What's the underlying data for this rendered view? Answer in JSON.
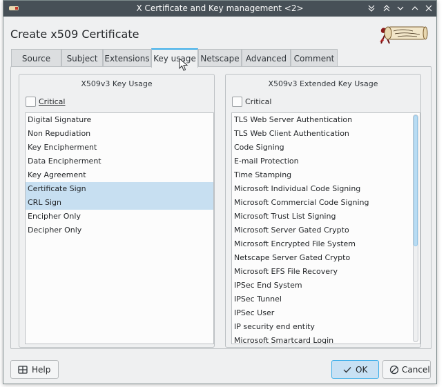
{
  "window": {
    "title": "X Certificate and Key management <2>"
  },
  "header": {
    "title": "Create x509 Certificate",
    "logo_icon": "certificate-scroll-logo"
  },
  "tabs": [
    {
      "label": "Source"
    },
    {
      "label": "Subject"
    },
    {
      "label": "Extensions"
    },
    {
      "label": "Key usage",
      "active": true
    },
    {
      "label": "Netscape"
    },
    {
      "label": "Advanced"
    },
    {
      "label": "Comment"
    }
  ],
  "key_usage": {
    "title": "X509v3 Key Usage",
    "critical_label": "Critical",
    "critical_checked": false,
    "items": [
      {
        "label": "Digital Signature",
        "selected": false
      },
      {
        "label": "Non Repudiation",
        "selected": false
      },
      {
        "label": "Key Encipherment",
        "selected": false
      },
      {
        "label": "Data Encipherment",
        "selected": false
      },
      {
        "label": "Key Agreement",
        "selected": false
      },
      {
        "label": "Certificate Sign",
        "selected": true
      },
      {
        "label": "CRL Sign",
        "selected": true
      },
      {
        "label": "Encipher Only",
        "selected": false
      },
      {
        "label": "Decipher Only",
        "selected": false
      }
    ]
  },
  "extended_key_usage": {
    "title": "X509v3 Extended Key Usage",
    "critical_label": "Critical",
    "critical_checked": false,
    "items": [
      "TLS Web Server Authentication",
      "TLS Web Client Authentication",
      "Code Signing",
      "E-mail Protection",
      "Time Stamping",
      "Microsoft Individual Code Signing",
      "Microsoft Commercial Code Signing",
      "Microsoft Trust List Signing",
      "Microsoft Server Gated Crypto",
      "Microsoft Encrypted File System",
      "Netscape Server Gated Crypto",
      "Microsoft EFS File Recovery",
      "IPSec End System",
      "IPSec Tunnel",
      "IPSec User",
      "IP security end entity",
      "Microsoft Smartcard Login"
    ]
  },
  "buttons": {
    "help": "Help",
    "ok": "OK",
    "cancel": "Cancel"
  },
  "colors": {
    "titlebar": "#475057",
    "accent": "#3daee9",
    "selection": "#c7dff1"
  }
}
